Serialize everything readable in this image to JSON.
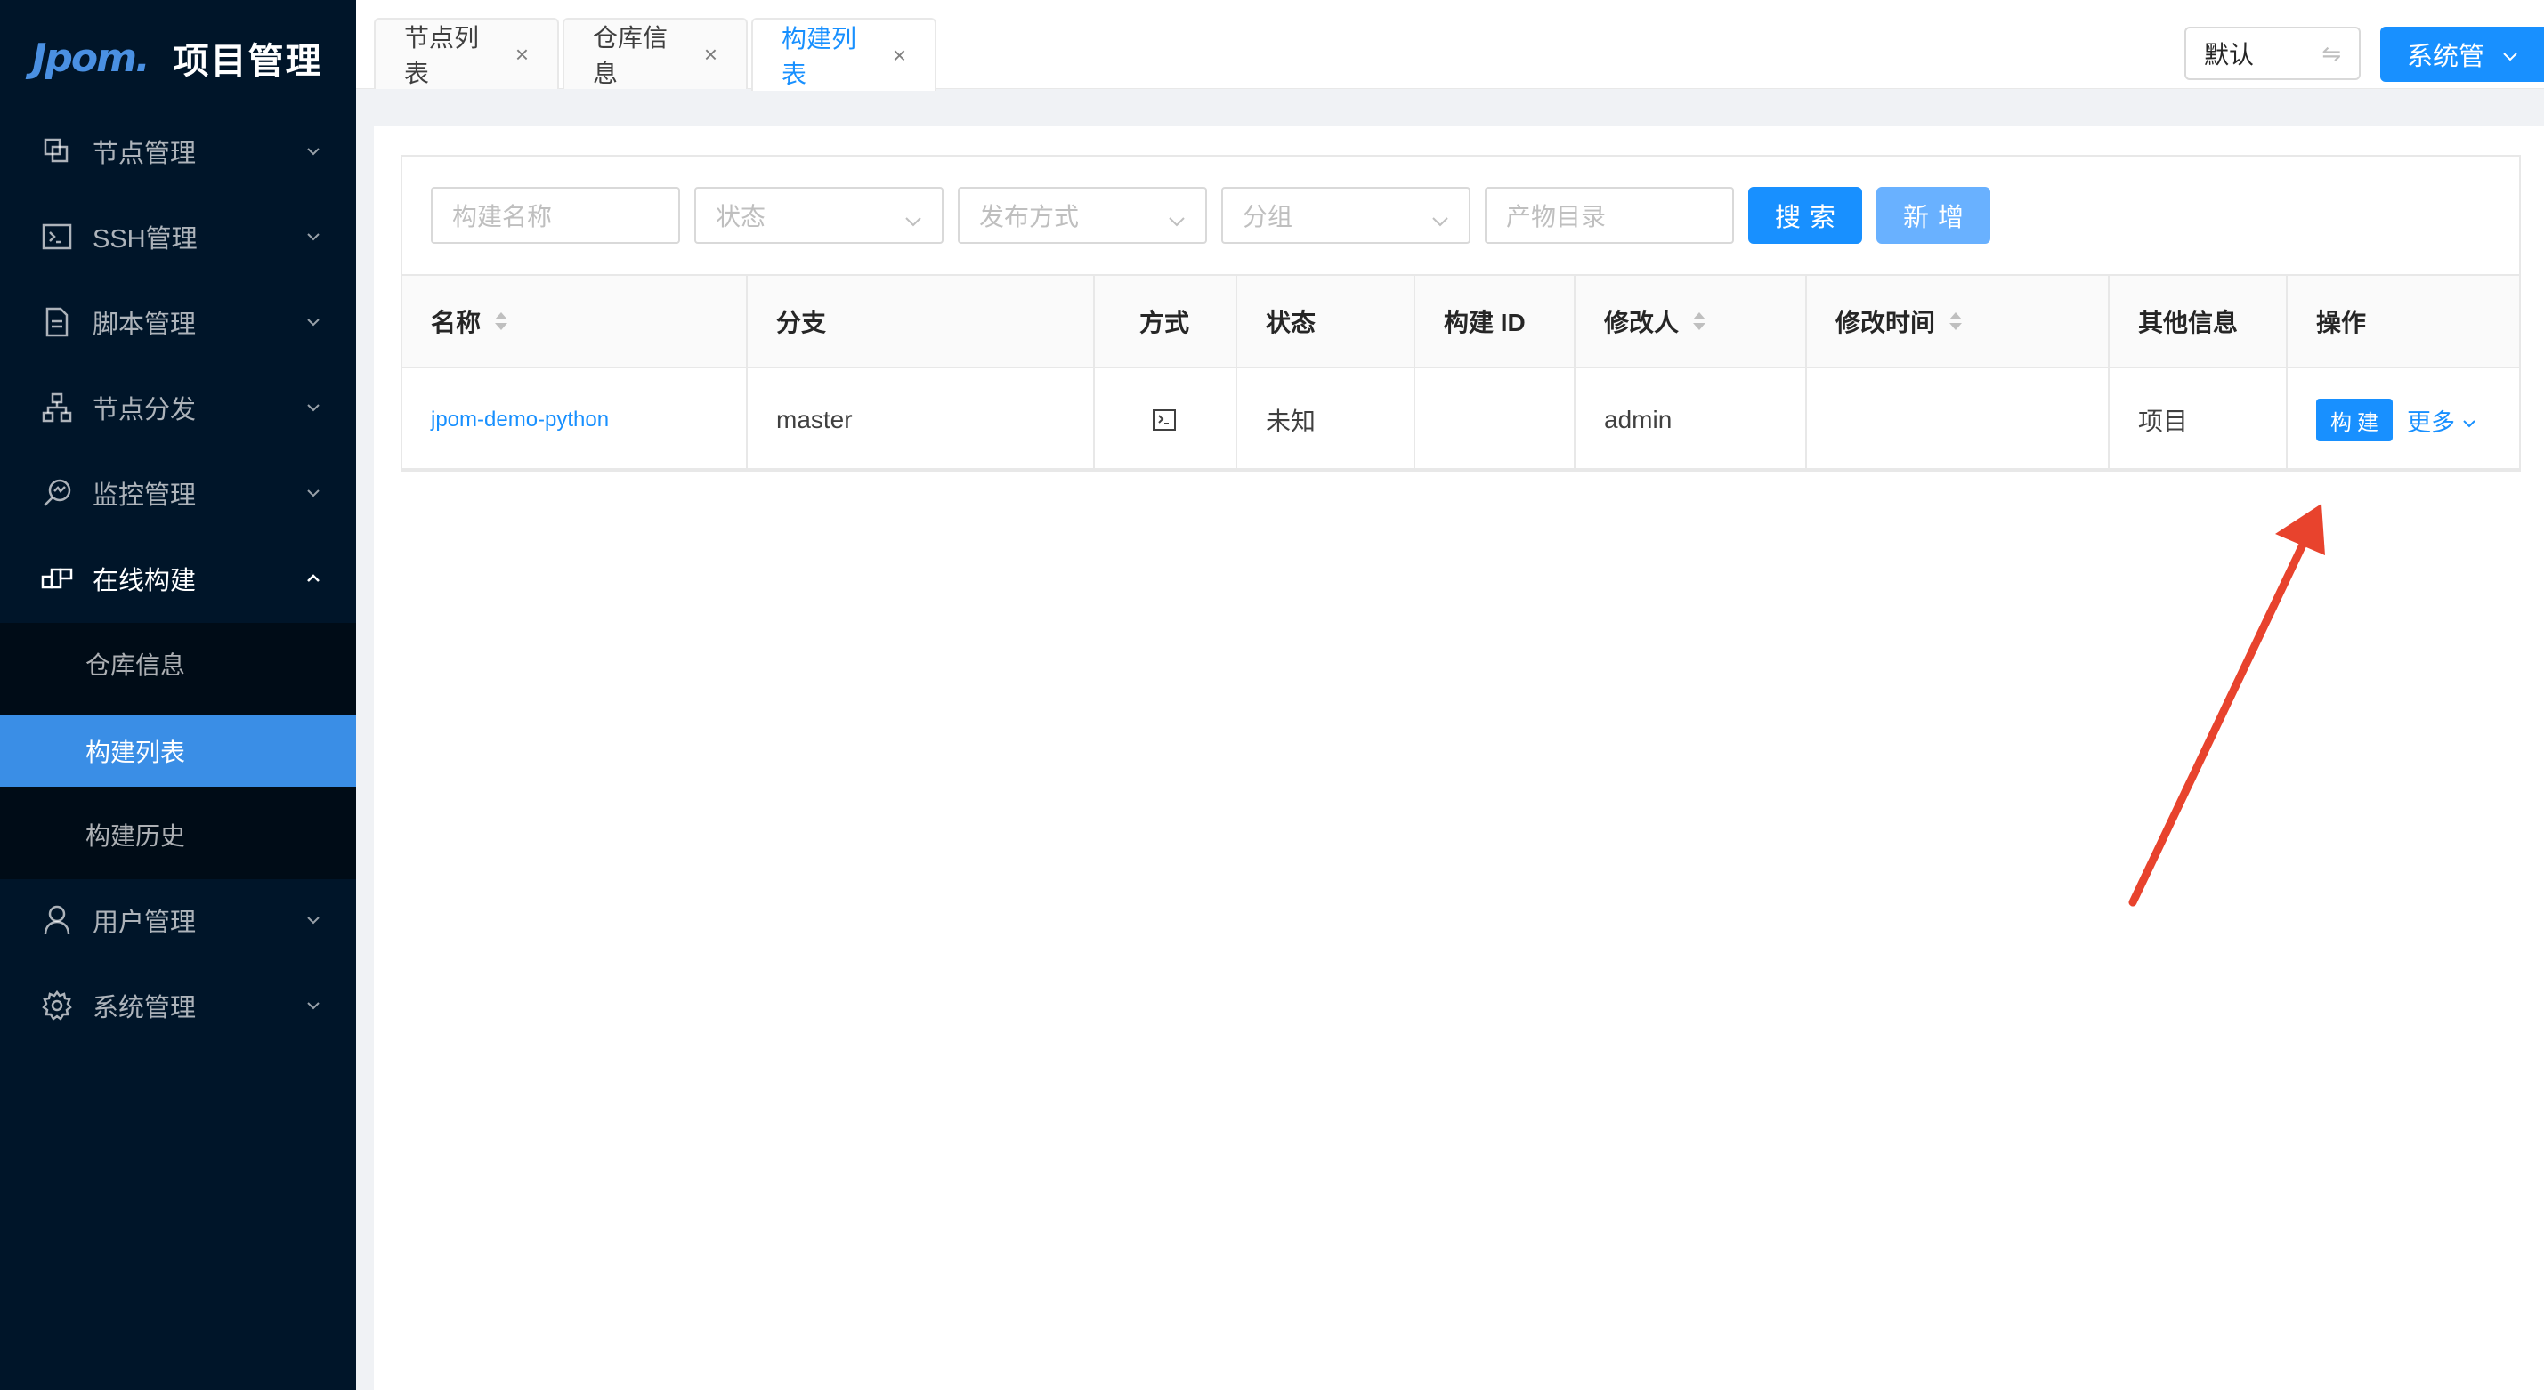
{
  "app": {
    "logo_mark": "Jpom.",
    "title": "项目管理"
  },
  "sidebar": {
    "items": [
      {
        "label": "节点管理",
        "icon": "nodes-icon"
      },
      {
        "label": "SSH管理",
        "icon": "terminal-icon"
      },
      {
        "label": "脚本管理",
        "icon": "file-icon"
      },
      {
        "label": "节点分发",
        "icon": "cluster-icon"
      },
      {
        "label": "监控管理",
        "icon": "monitor-icon"
      },
      {
        "label": "在线构建",
        "icon": "build-icon"
      },
      {
        "label": "用户管理",
        "icon": "user-icon"
      },
      {
        "label": "系统管理",
        "icon": "gear-icon"
      }
    ],
    "sub_items": [
      {
        "label": "仓库信息"
      },
      {
        "label": "构建列表"
      },
      {
        "label": "构建历史"
      }
    ]
  },
  "tabs": [
    {
      "label": "节点列表",
      "close": "×"
    },
    {
      "label": "仓库信息",
      "close": "×"
    },
    {
      "label": "构建列表",
      "close": "×"
    }
  ],
  "header": {
    "workspace": "默认",
    "swap_icon": "⇋",
    "user": "系统管"
  },
  "filters": {
    "name_placeholder": "构建名称",
    "status_placeholder": "状态",
    "release_placeholder": "发布方式",
    "group_placeholder": "分组",
    "artifact_placeholder": "产物目录",
    "search_label": "搜索",
    "add_label": "新增"
  },
  "table": {
    "columns": [
      "名称",
      "分支",
      "方式",
      "状态",
      "构建 ID",
      "修改人",
      "修改时间",
      "其他信息",
      "操作"
    ],
    "rows": [
      {
        "name": "jpom-demo-python",
        "branch": "master",
        "method_icon": "terminal-icon",
        "status": "未知",
        "build_id": "",
        "modifier": "admin",
        "modify_time": "",
        "other": "项目",
        "build_action": "构建",
        "more_action": "更多"
      }
    ]
  },
  "colors": {
    "sidebar_bg": "#001529",
    "primary": "#1890ff",
    "annotation_arrow": "#e8432d"
  }
}
